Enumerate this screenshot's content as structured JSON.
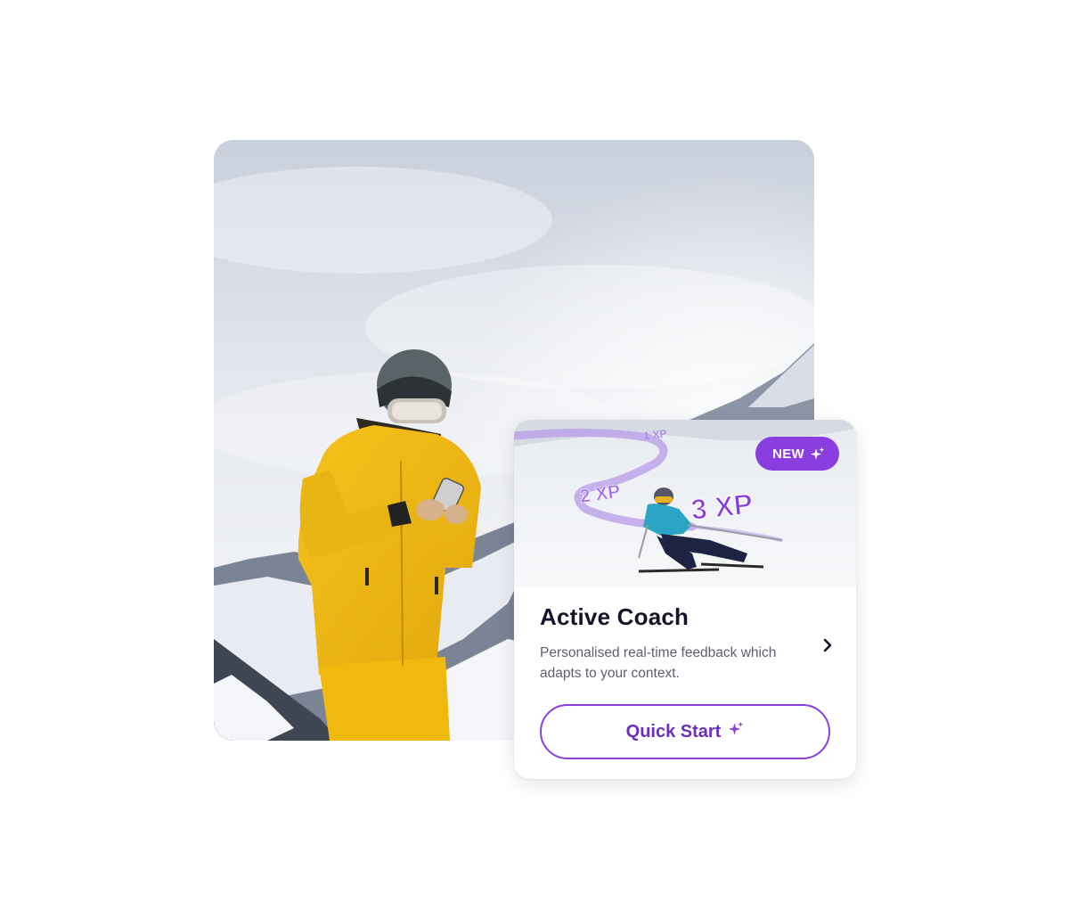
{
  "hero": {
    "image_description": "",
    "icon": "photo-icon"
  },
  "card": {
    "badge_label": "NEW",
    "badge_icon": "sparkle-icon",
    "xp_labels": [
      "1 XP",
      "2 XP",
      "3 XP"
    ],
    "title": "Active Coach",
    "description": "Personalised real-time feedback which adapts to your context.",
    "chevron_icon": "chevron-right-icon",
    "button_label": "Quick Start",
    "button_icon": "sparkle-icon"
  },
  "colors": {
    "accent": "#8a3ee0",
    "accent_text": "#6b2fc0",
    "title": "#14142b",
    "body_text": "#5c5f6e"
  }
}
